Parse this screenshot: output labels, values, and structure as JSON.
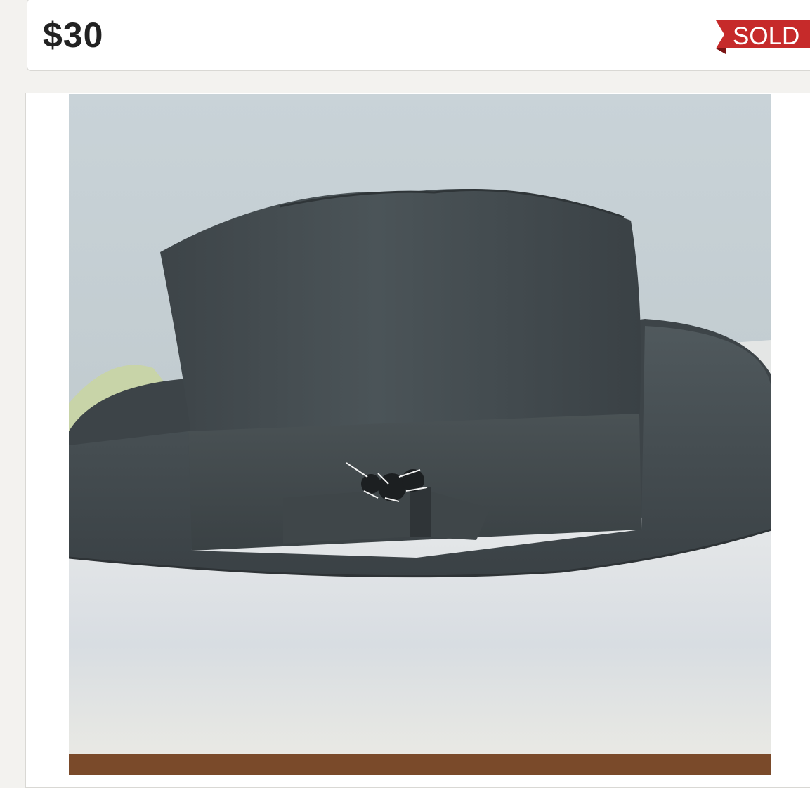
{
  "listing": {
    "price": "$30",
    "status_badge": "SOLD",
    "badge_color": "#c62a2a",
    "photo_subject": "gray-fedora-hat-photo"
  }
}
